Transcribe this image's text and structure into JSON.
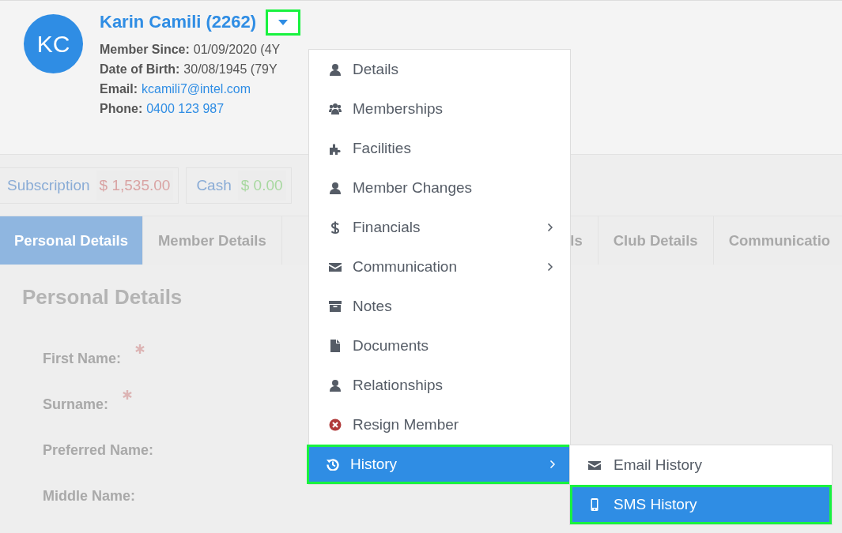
{
  "member": {
    "initials": "KC",
    "name": "Karin Camili (2262)",
    "menu_toggle": {
      "highlighted": true
    },
    "info": [
      {
        "label": "Member Since:",
        "value": "01/09/2020 (4Y",
        "kind": "text"
      },
      {
        "label": "Date of Birth:",
        "value": "30/08/1945 (79Y",
        "kind": "text"
      },
      {
        "label": "Email:",
        "value": "kcamili7@intel.com",
        "kind": "link"
      },
      {
        "label": "Phone:",
        "value": "0400 123 987",
        "kind": "link"
      }
    ]
  },
  "balances": [
    {
      "label": "Subscription",
      "value": "$ 1,535.00",
      "color": "#d9a3a3"
    },
    {
      "label": "Cash",
      "value": "$ 0.00",
      "color": "#a8d8a0"
    }
  ],
  "tabs": [
    {
      "label": "Personal Details",
      "selected": true
    },
    {
      "label": "Member Details",
      "selected": false
    },
    {
      "label": "ls",
      "selected": false
    },
    {
      "label": "Club Details",
      "selected": false
    },
    {
      "label": "Communicatio",
      "selected": false
    }
  ],
  "section": {
    "title": "Personal Details",
    "fields": [
      {
        "label": "First Name:",
        "required": true
      },
      {
        "label": "Surname:",
        "required": true
      },
      {
        "label": "Preferred Name:",
        "required": false
      },
      {
        "label": "Middle Name:",
        "required": false
      }
    ]
  },
  "menu": {
    "items": [
      {
        "label": "Details",
        "kind": "user",
        "has_submenu": false,
        "selected": false,
        "highlighted": false
      },
      {
        "label": "Memberships",
        "kind": "users",
        "has_submenu": false,
        "selected": false,
        "highlighted": false
      },
      {
        "label": "Facilities",
        "kind": "puzzle",
        "has_submenu": false,
        "selected": false,
        "highlighted": false
      },
      {
        "label": "Member Changes",
        "kind": "user",
        "has_submenu": false,
        "selected": false,
        "highlighted": false
      },
      {
        "label": "Financials",
        "kind": "dollar",
        "has_submenu": true,
        "selected": false,
        "highlighted": false
      },
      {
        "label": "Communication",
        "kind": "envelope",
        "has_submenu": true,
        "selected": false,
        "highlighted": false
      },
      {
        "label": "Notes",
        "kind": "archive",
        "has_submenu": false,
        "selected": false,
        "highlighted": false
      },
      {
        "label": "Documents",
        "kind": "file",
        "has_submenu": false,
        "selected": false,
        "highlighted": false
      },
      {
        "label": "Relationships",
        "kind": "user",
        "has_submenu": false,
        "selected": false,
        "highlighted": false
      },
      {
        "label": "Resign Member",
        "kind": "cancel",
        "has_submenu": false,
        "selected": false,
        "highlighted": false
      },
      {
        "label": "History",
        "kind": "history",
        "has_submenu": true,
        "selected": true,
        "highlighted": true
      }
    ]
  },
  "submenu": {
    "items": [
      {
        "label": "Email History",
        "kind": "envelope",
        "selected": false,
        "highlighted": false
      },
      {
        "label": "SMS History",
        "kind": "mobile",
        "selected": true,
        "highlighted": true
      }
    ]
  }
}
